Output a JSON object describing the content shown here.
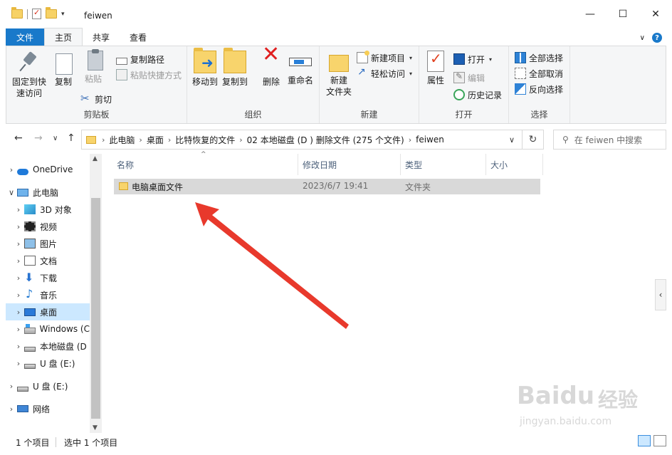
{
  "window": {
    "title": "feiwen",
    "minimize": "—",
    "maximize": "☐",
    "close": "✕"
  },
  "qat": {
    "dropdown": "▾",
    "sep": "|"
  },
  "tabs": [
    "文件",
    "主页",
    "共享",
    "查看"
  ],
  "help": {
    "collapse": "∨",
    "help": "?"
  },
  "ribbon": {
    "clipboard": {
      "label": "剪贴板",
      "pin": "固定到快\n速访问",
      "copy": "复制",
      "paste": "粘贴",
      "copy_path": "复制路径",
      "paste_shortcut": "粘贴快捷方式",
      "cut": "剪切"
    },
    "organize": {
      "label": "组织",
      "move_to": "移动到",
      "copy_to": "复制到",
      "delete": "删除",
      "rename": "重命名"
    },
    "new": {
      "label": "新建",
      "new_folder": "新建\n文件夹",
      "new_item": "新建项目",
      "easy_access": "轻松访问"
    },
    "open": {
      "label": "打开",
      "properties": "属性",
      "open": "打开",
      "edit": "编辑",
      "history": "历史记录"
    },
    "select": {
      "label": "选择",
      "select_all": "全部选择",
      "select_none": "全部取消",
      "invert": "反向选择"
    },
    "dropdown_glyph": "▾"
  },
  "nav": {
    "back": "←",
    "forward": "→",
    "recent": "∨",
    "up": "↑",
    "refresh": "↻",
    "address_dropdown": "∨",
    "chevron": "›"
  },
  "breadcrumb": [
    "此电脑",
    "桌面",
    "比特恢复的文件",
    "02 本地磁盘 (D ) 删除文件 (275 个文件)",
    "feiwen"
  ],
  "search": {
    "placeholder": "在 feiwen 中搜索",
    "icon": "⚲"
  },
  "navpane": {
    "expand_glyph": "›",
    "collapse_glyph": "∨",
    "items": [
      {
        "label": "OneDrive"
      },
      {
        "label": "此电脑"
      },
      {
        "label": "3D 对象"
      },
      {
        "label": "视频"
      },
      {
        "label": "图片"
      },
      {
        "label": "文档"
      },
      {
        "label": "下载"
      },
      {
        "label": "音乐"
      },
      {
        "label": "桌面"
      },
      {
        "label": "Windows (C"
      },
      {
        "label": "本地磁盘 (D"
      },
      {
        "label": "U 盘 (E:)"
      },
      {
        "label": "U 盘 (E:)"
      },
      {
        "label": "网络"
      }
    ]
  },
  "scroll": {
    "up": "▲",
    "down": "▼",
    "side_handle": "‹",
    "sort_arrow": "^"
  },
  "columns": {
    "name": "名称",
    "modified": "修改日期",
    "type": "类型",
    "size": "大小"
  },
  "files": [
    {
      "name": "电脑桌面文件",
      "modified": "2023/6/7 19:41",
      "type": "文件夹",
      "size": ""
    }
  ],
  "status": {
    "count": "1 个项目",
    "selected": "选中 1 个项目"
  },
  "watermark": {
    "brand": "Baidu",
    "cn": "经验",
    "url": "jingyan.baidu.com"
  },
  "colors": {
    "accent": "#1979ca",
    "selected": "#cce8ff",
    "arrow": "#e8392c"
  }
}
